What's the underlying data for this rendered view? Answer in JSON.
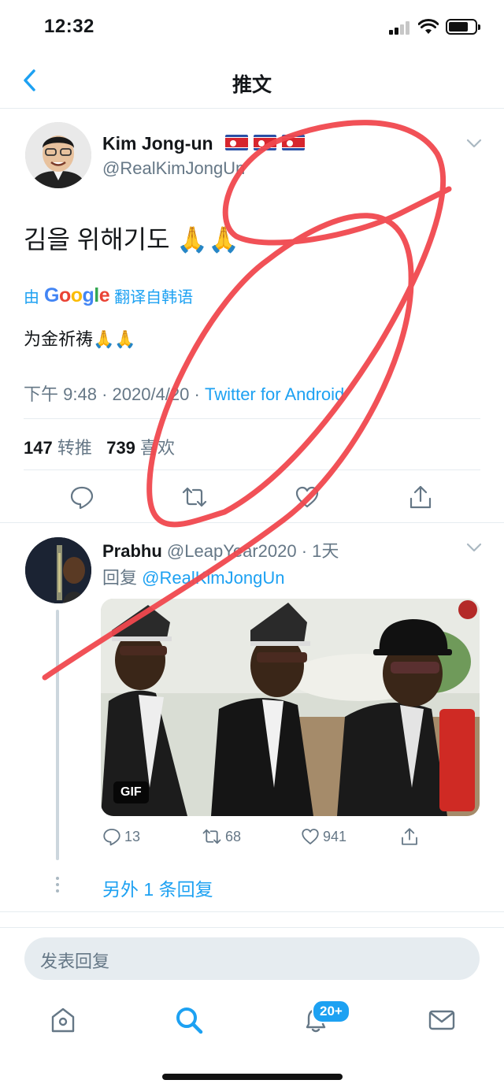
{
  "status_bar": {
    "time": "12:32"
  },
  "nav": {
    "title": "推文"
  },
  "tweet": {
    "author_name": "Kim Jong-un",
    "author_handle": "@RealKimJongUn",
    "text": "김을 위해기도 🙏🙏",
    "translation_prefix": "由",
    "translation_brand": "Google",
    "translation_suffix": "翻译自韩语",
    "translated_text": "为金祈祷🙏🙏",
    "time": "下午 9:48",
    "date": "2020/4/20",
    "separator": "·",
    "source": "Twitter for Android",
    "retweets_count": "147",
    "retweets_label": "转推",
    "likes_count": "739",
    "likes_label": "喜欢"
  },
  "reply": {
    "author_name": "Prabhu",
    "author_handle": "@LeapYear2020",
    "separator": "·",
    "age": "1天",
    "reply_prefix": "回复",
    "reply_mention": "@RealKimJongUn",
    "gif_label": "GIF",
    "comment_count": "13",
    "retweet_count": "68",
    "like_count": "941",
    "more_replies": "另外 1 条回复"
  },
  "composer": {
    "placeholder": "发表回复"
  },
  "tab_bar": {
    "notifications_badge": "20+"
  },
  "colors": {
    "accent": "#1da1f2",
    "secondary_text": "#657786",
    "scribble": "#f0484e"
  },
  "icons": [
    "back-arrow-icon",
    "caret-down-icon",
    "reply-icon",
    "retweet-icon",
    "like-icon",
    "share-icon",
    "home-icon",
    "search-icon",
    "notifications-icon",
    "messages-icon"
  ]
}
